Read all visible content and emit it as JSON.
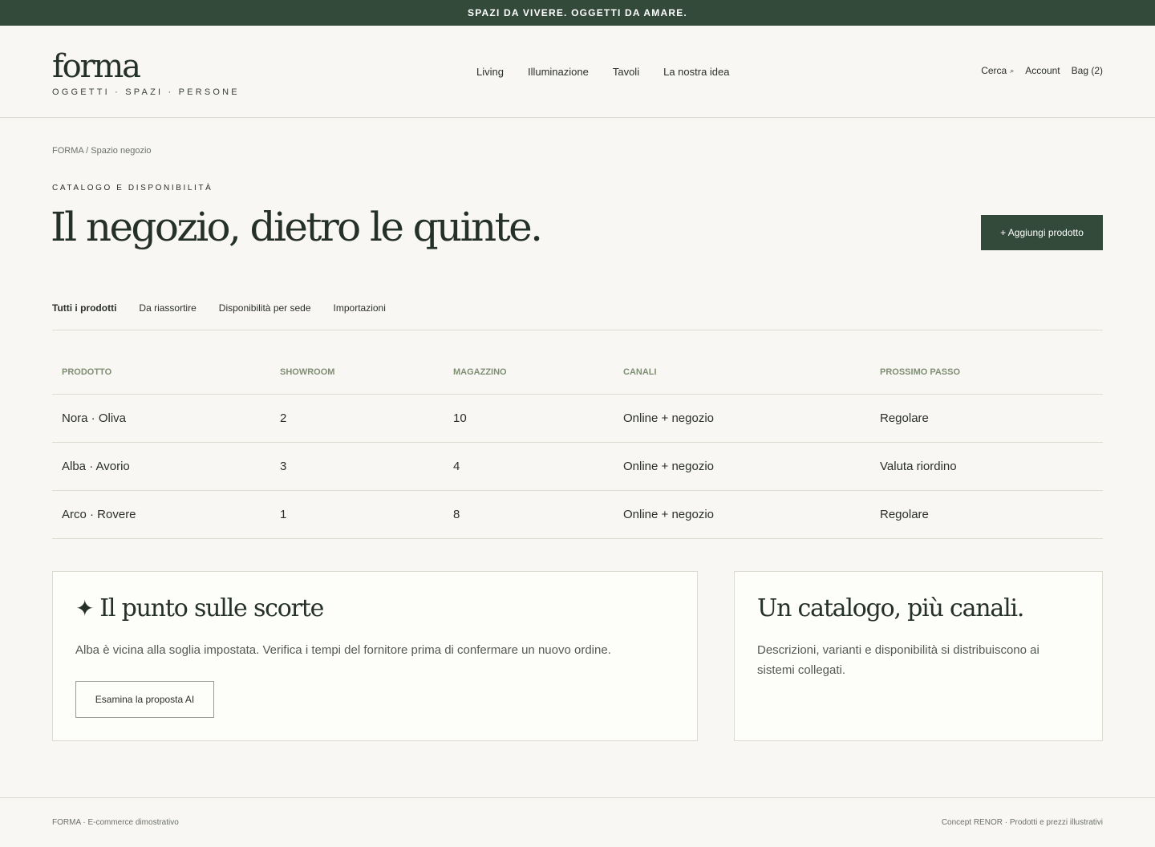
{
  "announcement": "SPAZI DA VIVERE. OGGETTI DA AMARE.",
  "brand": {
    "logo": "forma",
    "tagline": "OGGETTI · SPAZI · PERSONE"
  },
  "nav": {
    "items": [
      "Living",
      "Illuminazione",
      "Tavoli",
      "La nostra idea"
    ]
  },
  "utility": {
    "search": "Cerca",
    "search_icon": "search-icon",
    "account": "Account",
    "bag": "Bag (2)"
  },
  "breadcrumb": "FORMA / Spazio negozio",
  "eyebrow": "CATALOGO E DISPONIBILITÀ",
  "title": "Il negozio, dietro le quinte.",
  "add_button": "+ Aggiungi prodotto",
  "tabs": [
    "Tutti i prodotti",
    "Da riassortire",
    "Disponibilità per sede",
    "Importazioni"
  ],
  "table": {
    "headers": [
      "PRODOTTO",
      "SHOWROOM",
      "MAGAZZINO",
      "CANALI",
      "PROSSIMO PASSO"
    ],
    "rows": [
      [
        "Nora · Oliva",
        "2",
        "10",
        "Online + negozio",
        "Regolare"
      ],
      [
        "Alba · Avorio",
        "3",
        "4",
        "Online + negozio",
        "Valuta riordino"
      ],
      [
        "Arco · Rovere",
        "1",
        "8",
        "Online + negozio",
        "Regolare"
      ]
    ]
  },
  "ai_card": {
    "icon": "sparkle-icon",
    "title": "Il punto sulle scorte",
    "body": "Alba è vicina alla soglia impostata. Verifica i tempi del fornitore prima di confermare un nuovo ordine.",
    "button": "Esamina la proposta AI"
  },
  "catalog_card": {
    "title": "Un catalogo, più canali.",
    "body": "Descrizioni, varianti e disponibilità si distribuiscono ai sistemi collegati."
  },
  "footer": {
    "left": "FORMA · E-commerce dimostrativo",
    "right": "Concept RENOR · Prodotti e prezzi illustrativi"
  },
  "colors": {
    "accent": "#334a3b",
    "background": "#f8f7f3",
    "header_label": "#7f8f74"
  }
}
